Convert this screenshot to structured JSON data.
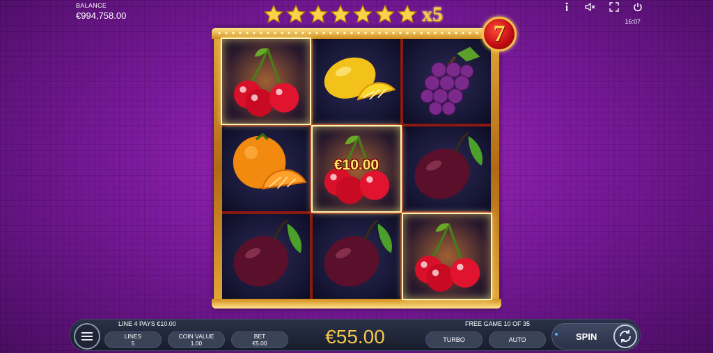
{
  "balance": {
    "label": "BALANCE",
    "value": "€994,758.00"
  },
  "topbar": {
    "clock": "16:07",
    "icons": [
      "info-icon",
      "mute-icon",
      "fullscreen-icon",
      "power-icon"
    ]
  },
  "stars": {
    "count": 7,
    "multiplier": "x5"
  },
  "badge": {
    "symbol": "7"
  },
  "reels": {
    "grid": [
      [
        "cherry",
        "lemon",
        "grapes"
      ],
      [
        "orange",
        "cherry",
        "plum"
      ],
      [
        "plum",
        "plum",
        "cherry"
      ]
    ],
    "winning_cells": [
      [
        0,
        0
      ],
      [
        1,
        1
      ],
      [
        2,
        2
      ]
    ],
    "win_amount": "€10.00"
  },
  "bottom": {
    "line_pays": "LINE 4 PAYS €10.00",
    "free_game": "FREE GAME 10 OF 35",
    "lines_label": "LINES",
    "lines_value": "5",
    "coin_label": "COIN VALUE",
    "coin_value": "1.00",
    "bet_label": "BET",
    "bet_value": "€5.00",
    "total_bet": "€55.00",
    "turbo_label": "TURBO",
    "auto_label": "AUTO",
    "spin_label": "SPIN"
  },
  "colors": {
    "background": "#7a1a9c",
    "gold": "#f6c84a",
    "bar": "#1f2536"
  }
}
